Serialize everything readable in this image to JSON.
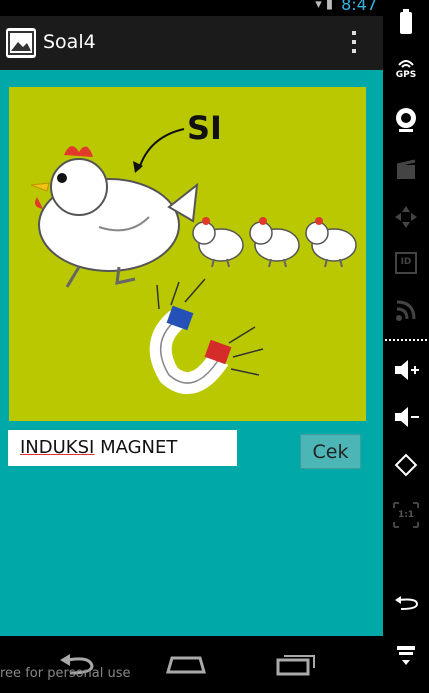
{
  "status_bar": {
    "time": "8:47"
  },
  "action_bar": {
    "title": "Soal4"
  },
  "content": {
    "picture": {
      "caption": "SI"
    },
    "answer_input": {
      "value_underlined": "INDUKSI",
      "value_rest": " MAGNET"
    },
    "check_button": "Cek"
  },
  "watermark": "ree for personal use",
  "side_panel": {
    "gps": "GPS",
    "id": "ID",
    "ratio": "1:1"
  },
  "colors": {
    "background": "#00a8a8",
    "picture_bg": "#b9c800",
    "action_bar": "#1b1b1b"
  }
}
